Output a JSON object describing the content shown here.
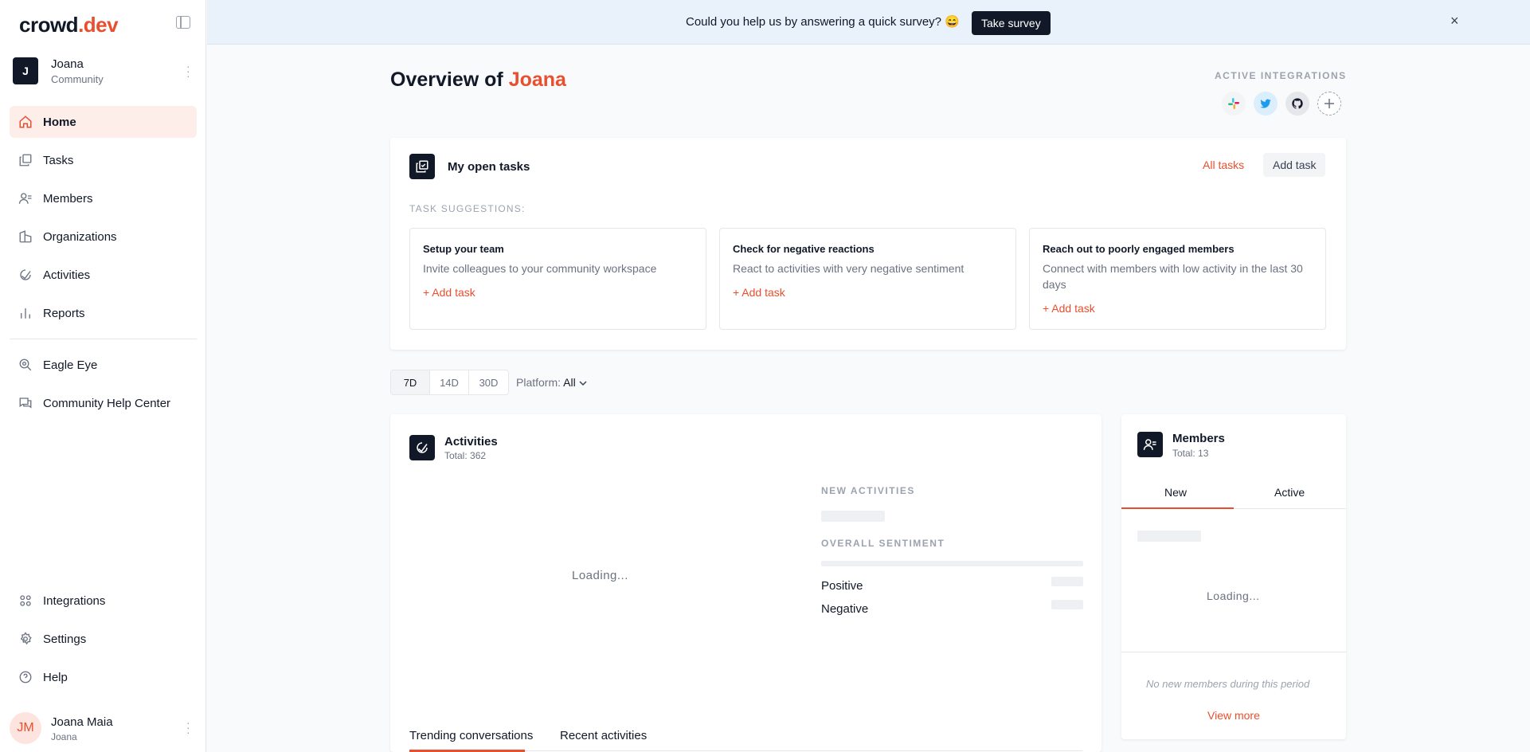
{
  "app": {
    "logo_main": "crowd",
    "logo_accent": ".dev"
  },
  "workspace": {
    "initial": "J",
    "name": "Joana",
    "type": "Community"
  },
  "nav": {
    "items": [
      {
        "label": "Home",
        "icon": "home-icon",
        "active": true
      },
      {
        "label": "Tasks",
        "icon": "tasks-icon"
      },
      {
        "label": "Members",
        "icon": "members-icon"
      },
      {
        "label": "Organizations",
        "icon": "organizations-icon"
      },
      {
        "label": "Activities",
        "icon": "activities-icon"
      },
      {
        "label": "Reports",
        "icon": "reports-icon"
      }
    ],
    "secondary": [
      {
        "label": "Eagle Eye",
        "icon": "eagle-eye-icon"
      },
      {
        "label": "Community Help Center",
        "icon": "help-center-icon"
      }
    ],
    "bottom": [
      {
        "label": "Integrations",
        "icon": "integrations-icon"
      },
      {
        "label": "Settings",
        "icon": "settings-icon"
      },
      {
        "label": "Help",
        "icon": "help-icon"
      }
    ]
  },
  "user": {
    "initials": "JM",
    "name": "Joana Maia",
    "workspace": "Joana"
  },
  "banner": {
    "text": "Could you help us by answering a quick survey? 😄",
    "button": "Take survey",
    "close": "×"
  },
  "header": {
    "title_prefix": "Overview of",
    "title_name": "Joana"
  },
  "integrations": {
    "title": "ACTIVE INTEGRATIONS",
    "icons": [
      "slack-icon",
      "twitter-icon",
      "github-icon",
      "add-integration-icon"
    ]
  },
  "tasks": {
    "title": "My open tasks",
    "all_link": "All tasks",
    "add_button": "Add task",
    "suggestions_title": "TASK SUGGESTIONS:",
    "suggestions": [
      {
        "title": "Setup your team",
        "description": "Invite colleagues to your community workspace",
        "action": "+ Add task"
      },
      {
        "title": "Check for negative reactions",
        "description": "React to activities with very negative sentiment",
        "action": "+ Add task"
      },
      {
        "title": "Reach out to poorly engaged members",
        "description": "Connect with members with low activity in the last 30 days",
        "action": "+ Add task"
      }
    ]
  },
  "filters": {
    "ranges": [
      "7D",
      "14D",
      "30D"
    ],
    "active_range": "7D",
    "platform_label": "Platform:",
    "platform_value": "All"
  },
  "activities": {
    "title": "Activities",
    "total": "Total: 362",
    "loading": "Loading...",
    "new_label": "NEW ACTIVITIES",
    "sentiment_label": "OVERALL SENTIMENT",
    "positive": "Positive",
    "negative": "Negative",
    "tabs": [
      "Trending conversations",
      "Recent activities"
    ],
    "active_tab": "Trending conversations"
  },
  "members": {
    "title": "Members",
    "total": "Total: 13",
    "tabs": [
      "New",
      "Active"
    ],
    "active_tab": "New",
    "loading": "Loading...",
    "empty": "No new members during this period",
    "view_more": "View more"
  },
  "colors": {
    "accent": "#e94f2e",
    "dark": "#111827",
    "muted": "#6b7280",
    "banner_bg": "#e9f1fb"
  }
}
